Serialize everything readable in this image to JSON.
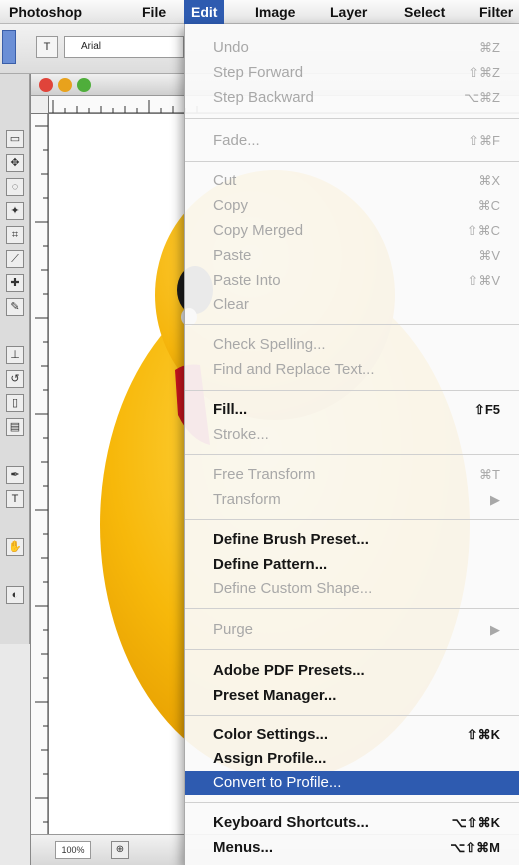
{
  "menubar": {
    "app": "Photoshop",
    "file": "File",
    "edit": "Edit",
    "image": "Image",
    "layer": "Layer",
    "select": "Select",
    "filter": "Filter"
  },
  "options": {
    "font_value": "Arial"
  },
  "doc": {
    "zoom": "100%"
  },
  "edit_menu": {
    "undo": {
      "label": "Undo",
      "shortcut": "⌘Z"
    },
    "step_forward": {
      "label": "Step Forward",
      "shortcut": "⇧⌘Z"
    },
    "step_backward": {
      "label": "Step Backward",
      "shortcut": "⌥⌘Z"
    },
    "fade": {
      "label": "Fade...",
      "shortcut": "⇧⌘F"
    },
    "cut": {
      "label": "Cut",
      "shortcut": "⌘X"
    },
    "copy": {
      "label": "Copy",
      "shortcut": "⌘C"
    },
    "copy_merged": {
      "label": "Copy Merged",
      "shortcut": "⇧⌘C"
    },
    "paste": {
      "label": "Paste",
      "shortcut": "⌘V"
    },
    "paste_into": {
      "label": "Paste Into",
      "shortcut": "⇧⌘V"
    },
    "clear": {
      "label": "Clear"
    },
    "check_spelling": {
      "label": "Check Spelling..."
    },
    "find_replace": {
      "label": "Find and Replace Text..."
    },
    "fill": {
      "label": "Fill...",
      "shortcut": "⇧F5"
    },
    "stroke": {
      "label": "Stroke..."
    },
    "free_transform": {
      "label": "Free Transform",
      "shortcut": "⌘T"
    },
    "transform": {
      "label": "Transform",
      "arrow": "▶"
    },
    "define_brush": {
      "label": "Define Brush Preset..."
    },
    "define_pattern": {
      "label": "Define Pattern..."
    },
    "define_shape": {
      "label": "Define Custom Shape..."
    },
    "purge": {
      "label": "Purge",
      "arrow": "▶"
    },
    "pdf_presets": {
      "label": "Adobe PDF Presets..."
    },
    "preset_manager": {
      "label": "Preset Manager..."
    },
    "color_settings": {
      "label": "Color Settings...",
      "shortcut": "⇧⌘K"
    },
    "assign_profile": {
      "label": "Assign Profile..."
    },
    "convert_profile": {
      "label": "Convert to Profile..."
    },
    "keyboard_shortcuts": {
      "label": "Keyboard Shortcuts...",
      "shortcut": "⌥⇧⌘K"
    },
    "menus": {
      "label": "Menus...",
      "shortcut": "⌥⇧⌘M"
    }
  },
  "colors": {
    "highlight": "#2e5bb0",
    "duck_yellow": "#f7b80a",
    "duck_beak": "#c8141e"
  }
}
